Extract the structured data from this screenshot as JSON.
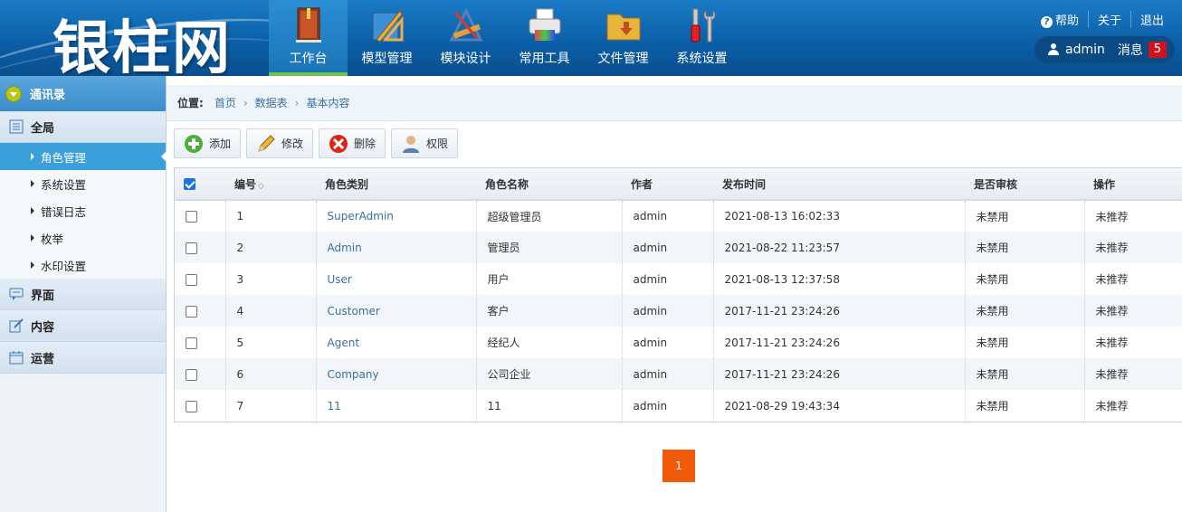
{
  "app": {
    "logo": "银柱网"
  },
  "nav": [
    {
      "label": "工作台",
      "icon": "book-icon"
    },
    {
      "label": "模型管理",
      "icon": "ruler-icon"
    },
    {
      "label": "模块设计",
      "icon": "design-tools-icon"
    },
    {
      "label": "常用工具",
      "icon": "printer-icon"
    },
    {
      "label": "文件管理",
      "icon": "folder-icon"
    },
    {
      "label": "系统设置",
      "icon": "wrench-icon"
    }
  ],
  "top_links": {
    "help": "帮助",
    "about": "关于",
    "logout": "退出"
  },
  "user": {
    "name": "admin",
    "messages_label": "消息",
    "message_count": "5"
  },
  "sidebar": {
    "header": "通讯录",
    "groups": [
      {
        "label": "全局",
        "icon": "list-icon"
      },
      {
        "label": "界面",
        "icon": "chat-icon"
      },
      {
        "label": "内容",
        "icon": "edit-icon"
      },
      {
        "label": "运营",
        "icon": "calendar-icon"
      }
    ],
    "items": [
      "角色管理",
      "系统设置",
      "错误日志",
      "枚举",
      "水印设置"
    ]
  },
  "breadcrumb": {
    "label": "位置:",
    "items": [
      "首页",
      "数据表",
      "基本内容"
    ]
  },
  "toolbar": {
    "add": "添加",
    "edit": "修改",
    "delete": "删除",
    "permission": "权限"
  },
  "table": {
    "headers": [
      "编号",
      "角色类别",
      "角色名称",
      "作者",
      "发布时间",
      "是否审核",
      "操作"
    ],
    "rows": [
      [
        "1",
        "SuperAdmin",
        "超级管理员",
        "admin",
        "2021-08-13 16:02:33",
        "未禁用",
        "未推荐"
      ],
      [
        "2",
        "Admin",
        "管理员",
        "admin",
        "2021-08-22 11:23:57",
        "未禁用",
        "未推荐"
      ],
      [
        "3",
        "User",
        "用户",
        "admin",
        "2021-08-13 12:37:58",
        "未禁用",
        "未推荐"
      ],
      [
        "4",
        "Customer",
        "客户",
        "admin",
        "2017-11-21 23:24:26",
        "未禁用",
        "未推荐"
      ],
      [
        "5",
        "Agent",
        "经纪人",
        "admin",
        "2017-11-21 23:24:26",
        "未禁用",
        "未推荐"
      ],
      [
        "6",
        "Company",
        "公司企业",
        "admin",
        "2017-11-21 23:24:26",
        "未禁用",
        "未推荐"
      ],
      [
        "7",
        "11",
        "11",
        "admin",
        "2021-08-29 19:43:34",
        "未禁用",
        "未推荐"
      ]
    ]
  },
  "pager": {
    "current": "1"
  },
  "colors": {
    "header_blue": "#0b5fa8",
    "active_blue": "#3aa0dc",
    "pager_orange": "#f15a0b",
    "badge_red": "#d0121b",
    "link": "#3b6f9c"
  }
}
